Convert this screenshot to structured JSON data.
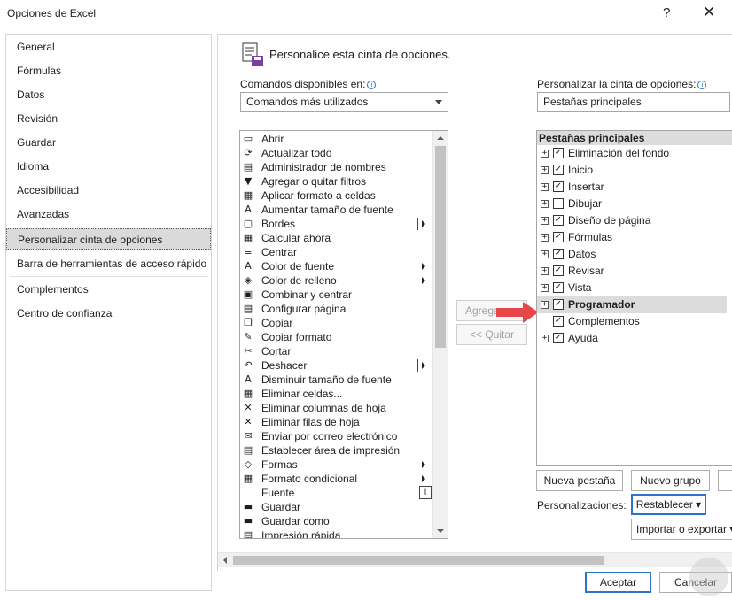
{
  "window": {
    "title": "Opciones de Excel",
    "help_glyph": "?",
    "close_glyph": "✕"
  },
  "sidebar": {
    "items": [
      {
        "label": "General"
      },
      {
        "label": "Fórmulas"
      },
      {
        "label": "Datos"
      },
      {
        "label": "Revisión"
      },
      {
        "label": "Guardar"
      },
      {
        "label": "Idioma"
      },
      {
        "label": "Accesibilidad"
      },
      {
        "label": "Avanzadas"
      },
      {
        "label": "Personalizar cinta de opciones",
        "active": true
      },
      {
        "label": "Barra de herramientas de acceso rápido"
      },
      {
        "label": "Complementos"
      },
      {
        "label": "Centro de confianza"
      }
    ]
  },
  "main": {
    "heading": "Personalice esta cinta de opciones.",
    "commands_label": "Comandos disponibles en:",
    "commands_value": "Comandos más utilizados",
    "ribbon_label": "Personalizar la cinta de opciones:",
    "ribbon_value": "Pestañas principales",
    "commands": [
      {
        "label": "Abrir",
        "icon": "folder-icon",
        "glyph": "▭"
      },
      {
        "label": "Actualizar todo",
        "icon": "refresh-icon",
        "glyph": "⟳"
      },
      {
        "label": "Administrador de nombres",
        "icon": "name-manager-icon",
        "glyph": "▤"
      },
      {
        "label": "Agregar o quitar filtros",
        "icon": "filter-icon",
        "glyph": "▼"
      },
      {
        "label": "Aplicar formato a celdas",
        "icon": "format-cells-icon",
        "glyph": "▦"
      },
      {
        "label": "Aumentar tamaño de fuente",
        "icon": "font-grow-icon",
        "glyph": "A"
      },
      {
        "label": "Bordes",
        "icon": "borders-icon",
        "glyph": "▢",
        "submenu": "split"
      },
      {
        "label": "Calcular ahora",
        "icon": "calculator-icon",
        "glyph": "▦"
      },
      {
        "label": "Centrar",
        "icon": "align-center-icon",
        "glyph": "≡"
      },
      {
        "label": "Color de fuente",
        "icon": "font-color-icon",
        "glyph": "A",
        "submenu": "arrow"
      },
      {
        "label": "Color de relleno",
        "icon": "fill-color-icon",
        "glyph": "◈",
        "submenu": "arrow"
      },
      {
        "label": "Combinar y centrar",
        "icon": "merge-icon",
        "glyph": "▣"
      },
      {
        "label": "Configurar página",
        "icon": "page-setup-icon",
        "glyph": "▤"
      },
      {
        "label": "Copiar",
        "icon": "copy-icon",
        "glyph": "❐"
      },
      {
        "label": "Copiar formato",
        "icon": "format-painter-icon",
        "glyph": "✎"
      },
      {
        "label": "Cortar",
        "icon": "scissors-icon",
        "glyph": "✂"
      },
      {
        "label": "Deshacer",
        "icon": "undo-icon",
        "glyph": "↶",
        "submenu": "split"
      },
      {
        "label": "Disminuir tamaño de fuente",
        "icon": "font-shrink-icon",
        "glyph": "A"
      },
      {
        "label": "Eliminar celdas...",
        "icon": "delete-cells-icon",
        "glyph": "▦"
      },
      {
        "label": "Eliminar columnas de hoja",
        "icon": "delete-columns-icon",
        "glyph": "✕"
      },
      {
        "label": "Eliminar filas de hoja",
        "icon": "delete-rows-icon",
        "glyph": "✕"
      },
      {
        "label": "Enviar por correo electrónico",
        "icon": "email-icon",
        "glyph": "✉"
      },
      {
        "label": "Establecer área de impresión",
        "icon": "print-area-icon",
        "glyph": "▤"
      },
      {
        "label": "Formas",
        "icon": "shapes-icon",
        "glyph": "◇",
        "submenu": "arrow"
      },
      {
        "label": "Formato condicional",
        "icon": "conditional-format-icon",
        "glyph": "▦",
        "submenu": "arrow"
      },
      {
        "label": "Fuente",
        "icon": "",
        "glyph": "",
        "submenu": "fontbox"
      },
      {
        "label": "Guardar",
        "icon": "save-icon",
        "glyph": "▬"
      },
      {
        "label": "Guardar como",
        "icon": "save-as-icon",
        "glyph": "▬"
      },
      {
        "label": "Impresión rápida",
        "icon": "quick-print-icon",
        "glyph": "▤"
      }
    ],
    "fontbox_glyph": "I",
    "add_button": "Agregar >>",
    "remove_button": "<< Quitar",
    "tree_header": "Pestañas principales",
    "tree": [
      {
        "label": "Eliminación del fondo",
        "expander": "+",
        "checked": true
      },
      {
        "label": "Inicio",
        "expander": "+",
        "checked": true
      },
      {
        "label": "Insertar",
        "expander": "+",
        "checked": true
      },
      {
        "label": "Dibujar",
        "expander": "+",
        "checked": false
      },
      {
        "label": "Diseño de página",
        "expander": "+",
        "checked": true
      },
      {
        "label": "Fórmulas",
        "expander": "+",
        "checked": true
      },
      {
        "label": "Datos",
        "expander": "+",
        "checked": true
      },
      {
        "label": "Revisar",
        "expander": "+",
        "checked": true
      },
      {
        "label": "Vista",
        "expander": "+",
        "checked": true
      },
      {
        "label": "Programador",
        "expander": "+",
        "checked": true,
        "selected": true
      },
      {
        "label": "Complementos",
        "expander": "",
        "checked": true
      },
      {
        "label": "Ayuda",
        "expander": "+",
        "checked": true
      }
    ],
    "check_glyph": "✓",
    "new_tab_button": "Nueva pestaña",
    "new_group_button": "Nuevo grupo",
    "customizations_label": "Personalizaciones:",
    "reset_button": "Restablecer ▾",
    "import_export_button": "Importar o exportar ▾"
  },
  "footer": {
    "ok_button": "Aceptar",
    "cancel_button": "Cancelar"
  },
  "colors": {
    "accent": "#2b74c7",
    "selection": "#dadada",
    "arrow": "#e8474a"
  }
}
